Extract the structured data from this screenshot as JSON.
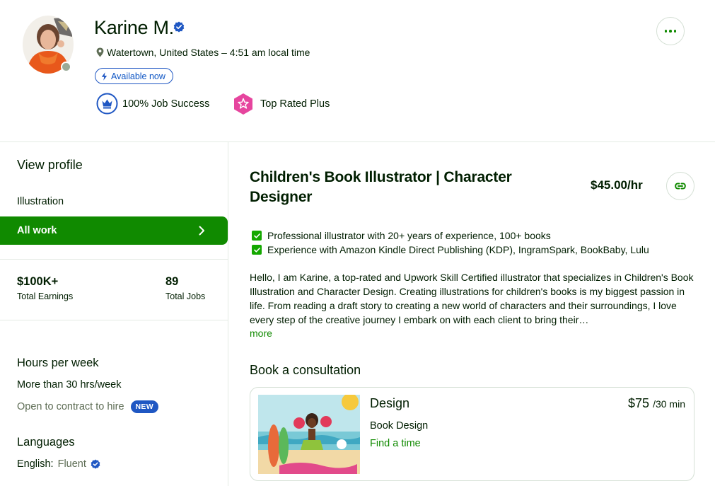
{
  "profile": {
    "name": "Karine M.",
    "location": "Watertown, United States – 4:51 am local time",
    "availability": "Available now",
    "job_success": "100% Job Success",
    "badge": "Top Rated Plus"
  },
  "sidebar": {
    "view_profile": "View profile",
    "category": "Illustration",
    "all_work": "All work",
    "stats": [
      {
        "value": "$100K+",
        "label": "Total Earnings"
      },
      {
        "value": "89",
        "label": "Total Jobs"
      }
    ],
    "hours_title": "Hours per week",
    "hours_value": "More than 30 hrs/week",
    "open_contract": "Open to contract to hire",
    "new_badge": "NEW",
    "languages_title": "Languages",
    "language_name": "English:",
    "language_level": "Fluent"
  },
  "main": {
    "title": "Children's Book Illustrator | Character Designer",
    "rate": "$45.00/hr",
    "bullets": [
      "Professional illustrator with 20+ years of experience, 100+ books",
      "Experience with Amazon Kindle Direct Publishing (KDP), IngramSpark, BookBaby, Lulu"
    ],
    "description": "Hello, I am Karine, a top-rated and Upwork Skill Certified illustrator that specializes in Children's Book Illustration and Character Design. Creating illustrations for children's books is my biggest passion in life. From reading a draft story to creating a new world of characters and their surroundings, I love every step of the creative journey I embark on with each client to bring their…",
    "more": "more",
    "consultation_title": "Book a consultation",
    "consultation": {
      "name": "Design",
      "price": "$75",
      "duration": "/30 min",
      "subtitle": "Book Design",
      "cta": "Find a time"
    }
  },
  "colors": {
    "brand_green": "#108a00",
    "verified_blue": "#1f57c3",
    "text": "#001e00",
    "badge_pink": "#e6459e"
  }
}
